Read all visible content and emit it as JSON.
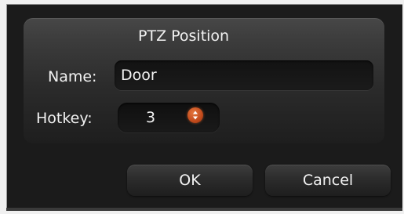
{
  "dialog": {
    "title": "PTZ Position",
    "name_label": "Name:",
    "name_value": "Door",
    "hotkey_label": "Hotkey:",
    "hotkey_value": "3",
    "ok_label": "OK",
    "cancel_label": "Cancel"
  },
  "icons": {
    "spin": "spin-arrows-icon"
  },
  "colors": {
    "background": "#1b1b1b",
    "panel": "#3c3c3c",
    "text": "#f2f2f2",
    "accent": "#c24a1b"
  }
}
